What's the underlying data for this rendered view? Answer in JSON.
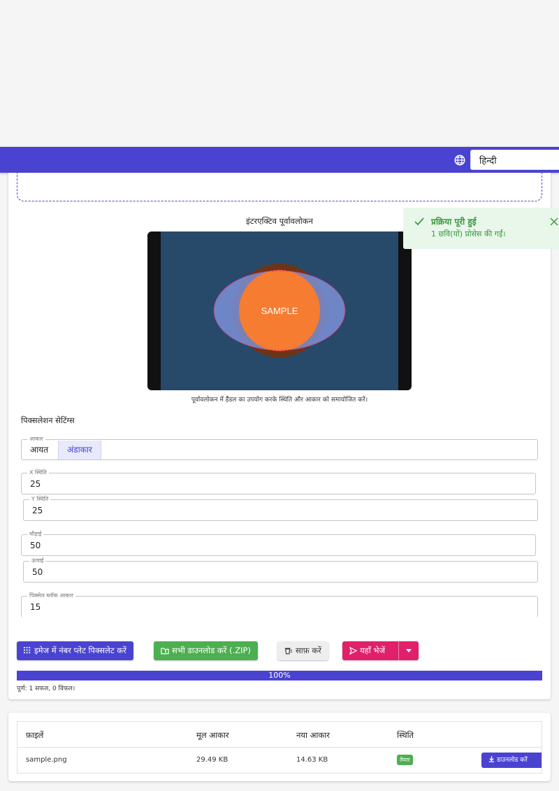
{
  "header": {
    "language_selected": "हिन्दी",
    "globe_icon": "globe-icon"
  },
  "preview": {
    "title": "इंटरएक्टिव पूर्वावलोकन",
    "sample_text": "SAMPLE",
    "hint": "पूर्वावलोकन में हैंडल का उपयोग करके स्थिति और आकार को समायोजित करें।"
  },
  "settings": {
    "title": "पिक्सलेशन सेटिंग्स",
    "shape_label": "आकार",
    "shape_options": [
      "आयत",
      "अंडाकार"
    ],
    "shape_selected": "अंडाकार",
    "x_label": "X स्थिति",
    "x_value": "25",
    "y_label": "Y स्थिति",
    "y_value": "25",
    "width_label": "चौड़ाई",
    "width_value": "50",
    "height_label": "ऊंचाई",
    "height_value": "50",
    "block_label": "पिक्सेल ब्लॉक आकार",
    "block_value": "15"
  },
  "actions": {
    "pixelate": "इमेज में नंबर प्लेट पिक्सलेट करें",
    "download_all": "सभी डाउनलोड करें (.ZIP)",
    "clear": "साफ़ करें",
    "send_here": "यहाँ भेजें"
  },
  "progress": {
    "value": 100,
    "label": "100%",
    "summary": "पूर्ण: 1 सफल, 0 विफल।"
  },
  "table": {
    "headers": [
      "फ़ाइलें",
      "मूल आकार",
      "नया आकार",
      "स्थिति"
    ],
    "rows": [
      {
        "name": "sample.png",
        "original": "29.49 KB",
        "new": "14.63 KB",
        "status": "तैयार",
        "action": "डाउनलोड करें"
      }
    ]
  },
  "toast": {
    "title": "प्रक्रिया पूरी हुई",
    "message": "1 छवि(यों) प्रोसेस की गईं।"
  },
  "colors": {
    "primary": "#4a43d1",
    "success": "#4caf50",
    "accent": "#e0206a",
    "preview_bg": "#27496a",
    "orange": "#f57c30"
  }
}
